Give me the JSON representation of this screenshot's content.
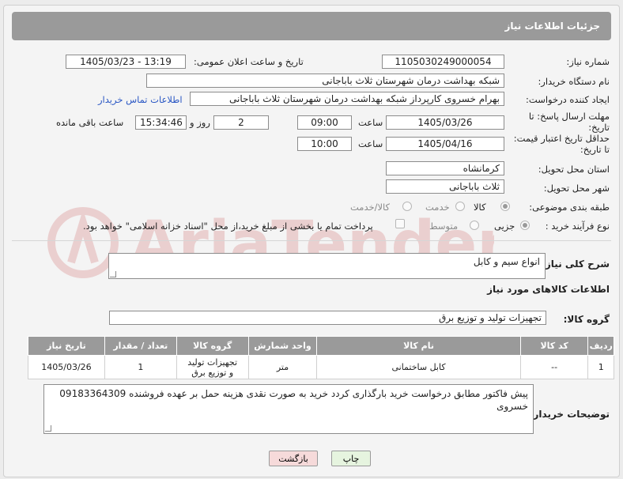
{
  "header": {
    "title": "جزئیات اطلاعات نیاز"
  },
  "fields": {
    "need_number_label": "شماره نیاز:",
    "need_number": "1105030249000054",
    "announce_label": "تاریخ و ساعت اعلان عمومی:",
    "announce_value": "1405/03/23 - 13:19",
    "buyer_org_label": "نام دستگاه خریدار:",
    "buyer_org": "شبکه بهداشت درمان شهرستان ثلاث باباجانی",
    "creator_label": "ایجاد کننده درخواست:",
    "creator": "بهرام خسروی کارپرداز شبکه بهداشت درمان شهرستان ثلاث باباجانی",
    "contact_link": "اطلاعات تماس خریدار",
    "deadline_label_1": "مهلت ارسال پاسخ: تا",
    "deadline_label_2": "تاریخ:",
    "deadline_date": "1405/03/26",
    "time_label": "ساعت",
    "deadline_time": "09:00",
    "days_value": "2",
    "days_label": "روز و",
    "remaining_time": "15:34:46",
    "remaining_label": "ساعت باقی مانده",
    "validity_label_1": "حداقل تاریخ اعتبار قیمت:",
    "validity_label_2": "تا تاریخ:",
    "validity_date": "1405/04/16",
    "validity_time": "10:00",
    "province_label": "استان محل تحویل:",
    "province": "کرمانشاه",
    "city_label": "شهر محل تحویل:",
    "city": "ثلاث باباجانی",
    "category_label": "طبقه بندی موضوعی:",
    "category_options": [
      "کالا",
      "خدمت",
      "کالا/خدمت"
    ],
    "process_label": "نوع فرآیند خرید :",
    "process_options": [
      "جزیی",
      "متوسط"
    ],
    "payment_note": "پرداخت تمام یا بخشی از مبلغ خرید،از محل \"اسناد خزانه اسلامی\" خواهد بود."
  },
  "description": {
    "label": "شرح کلی نیاز:",
    "value": "انواع سیم و کابل"
  },
  "goods_info": {
    "title": "اطلاعات کالاهای مورد نیاز",
    "group_label": "گروه کالا:",
    "group_value": "تجهیزات تولید و توزیع برق"
  },
  "table": {
    "headers": [
      "ردیف",
      "کد کالا",
      "نام کالا",
      "واحد شمارش",
      "گروه کالا",
      "تعداد / مقدار",
      "تاریخ نیاز"
    ],
    "rows": [
      {
        "row": "1",
        "code": "--",
        "name": "کابل ساختمانی",
        "unit": "متر",
        "group": "تجهیزات تولید و توزیع برق",
        "qty": "1",
        "date": "1405/03/26"
      }
    ]
  },
  "buyer_notes": {
    "label": "توضیحات خریدار:",
    "value": "پیش فاکتور مطابق درخواست خرید بارگذاری کردد خرید به صورت نقدی هزینه حمل بر عهده فروشنده 09183364309 خسروی"
  },
  "buttons": {
    "print": "چاپ",
    "back": "بازگشت"
  },
  "watermark": {
    "text": "AriaTender.net"
  },
  "colors": {
    "header_bg": "#9a9a9a",
    "link": "#2a57c4",
    "back_button_bg": "#f6dada",
    "print_button_bg": "#e6f4df"
  }
}
